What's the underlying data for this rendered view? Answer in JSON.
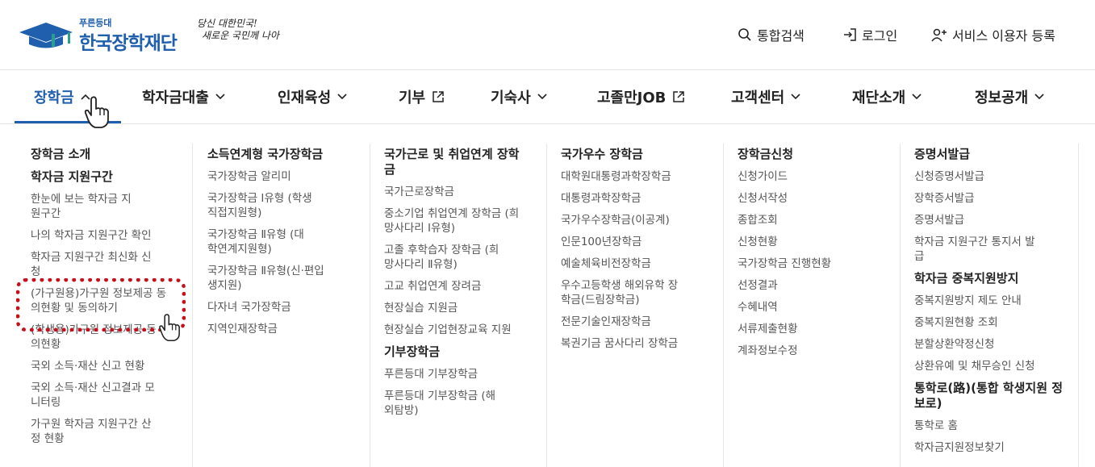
{
  "logo": {
    "small": "푸른등대",
    "name": "한국장학재단"
  },
  "slogan": [
    "당신 대한민국!",
    "새로운 국민께 나아"
  ],
  "util": {
    "search": "통합검색",
    "login": "로그인",
    "register": "서비스 이용자 등록"
  },
  "gnb": [
    {
      "label": "장학금",
      "icon": "chevron-up-icon"
    },
    {
      "label": "학자금대출",
      "icon": "chevron-down-icon"
    },
    {
      "label": "인재육성",
      "icon": "chevron-down-icon"
    },
    {
      "label": "기부",
      "icon": "external-link-icon"
    },
    {
      "label": "기숙사",
      "icon": "chevron-down-icon"
    },
    {
      "label": "고졸만JOB",
      "icon": "external-link-icon"
    },
    {
      "label": "고객센터",
      "icon": "chevron-down-icon"
    },
    {
      "label": "재단소개",
      "icon": "chevron-down-icon"
    },
    {
      "label": "정보공개",
      "icon": "chevron-down-icon"
    }
  ],
  "menu": {
    "col1": {
      "heading1": "장학금 소개",
      "heading2": "학자금 지원구간",
      "links": [
        "한눈에 보는 학자금 지원구간",
        "나의 학자금 지원구간 확인",
        "학자금 지원구간 최신화 신청",
        "(가구원용)가구원 정보제공 동의현황 및 동의하기",
        "(학생용)가구원 정보제공 동의현황",
        "국외 소득·재산 신고 현황",
        "국외 소득·재산 신고결과 모니터링",
        "가구원 학자금 지원구간 산정 현황"
      ]
    },
    "col2": {
      "heading1": "소득연계형 국가장학금",
      "links": [
        "국가장학금 알리미",
        "국가장학금 Ⅰ유형 (학생직접지원형)",
        "국가장학금 Ⅱ유형 (대학연계지원형)",
        "국가장학금 Ⅱ유형(신·편입생지원)",
        "다자녀 국가장학금",
        "지역인재장학금"
      ]
    },
    "col3": {
      "heading1": "국가근로 및 취업연계 장학금",
      "links": [
        "국가근로장학금",
        "중소기업 취업연계 장학금 (희망사다리 Ⅰ유형)",
        "고졸 후학습자 장학금 (희망사다리 Ⅱ유형)",
        "고교 취업연계 장려금",
        "현장실습 지원금",
        "현장실습 기업현장교육 지원"
      ],
      "heading2": "기부장학금",
      "links2": [
        "푸른등대 기부장학금",
        "푸른등대 기부장학금 (해외탐방)"
      ]
    },
    "col4": {
      "heading1": "국가우수 장학금",
      "links": [
        "대학원대통령과학장학금",
        "대통령과학장학금",
        "국가우수장학금(이공계)",
        "인문100년장학금",
        "예술체육비전장학금",
        "우수고등학생 해외유학 장학금(드림장학금)",
        "전문기술인재장학금",
        "복권기금 꿈사다리 장학금"
      ]
    },
    "col5": {
      "heading1": "장학금신청",
      "links": [
        "신청가이드",
        "신청서작성",
        "종합조회",
        "신청현황",
        "국가장학금 진행현황",
        "선정결과",
        "수혜내역",
        "서류제출현황",
        "계좌정보수정"
      ]
    },
    "col6": {
      "heading1": "증명서발급",
      "links": [
        "신청증명서발급",
        "장학증서발급",
        "증명서발급",
        "학자금 지원구간 통지서 발급"
      ],
      "heading2": "학자금 중복지원방지",
      "links2": [
        "중복지원방지 제도 안내",
        "중복지원현황 조회",
        "분할상환약정신청",
        "상환유예 및 채무승인 신청"
      ],
      "heading3": "통학로(路)(통합 학생지원 정보로)",
      "links3": [
        "통학로 홈",
        "학자금지원정보찾기"
      ]
    }
  },
  "colors": {
    "brand": "#1f5fad",
    "highlight": "#c8101a"
  }
}
